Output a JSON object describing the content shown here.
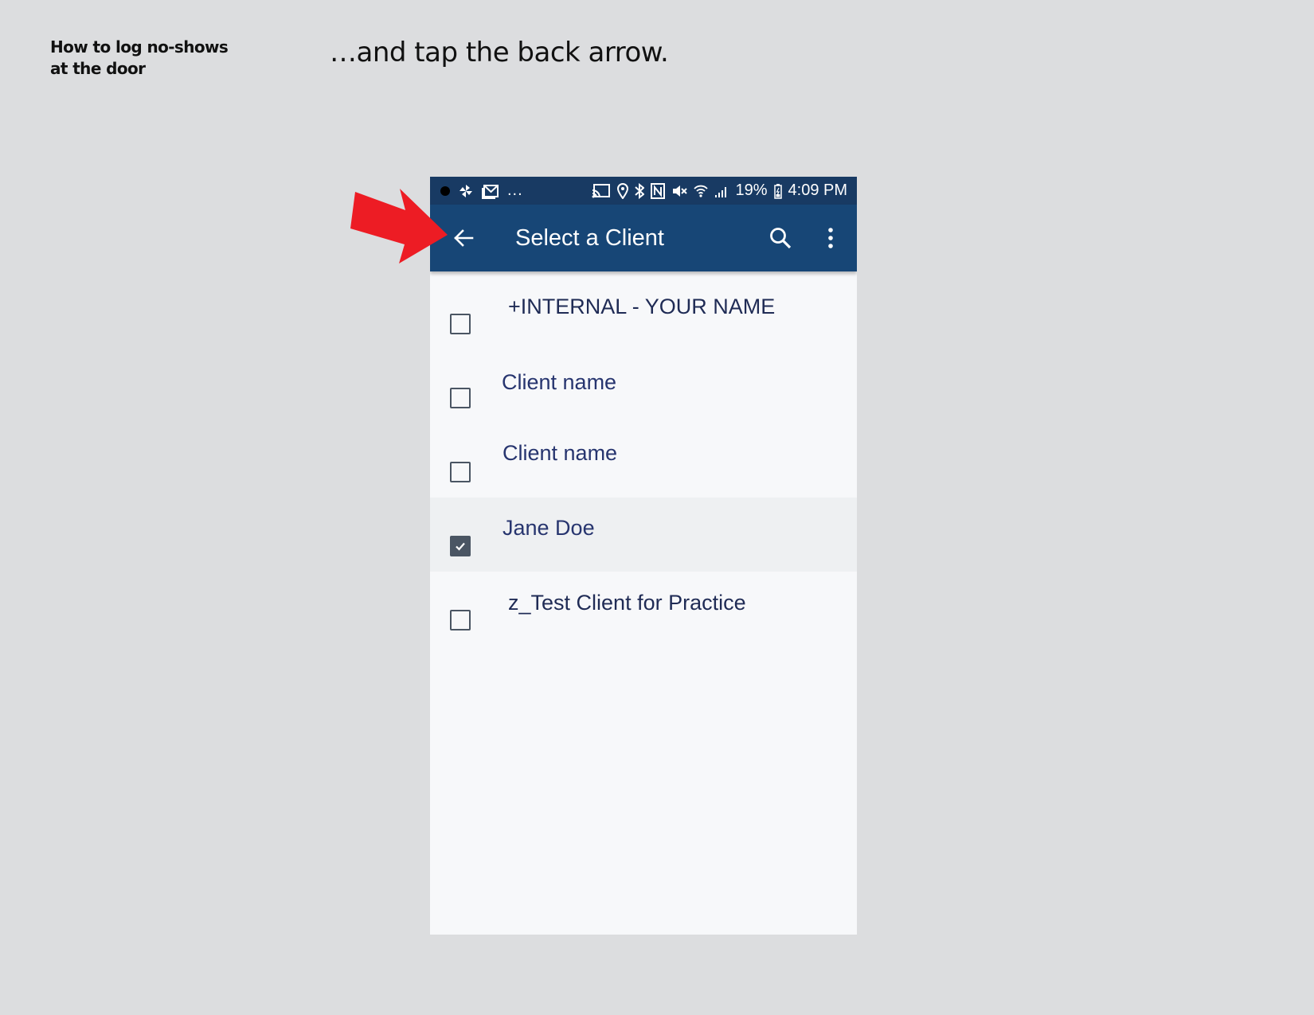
{
  "document": {
    "title_line1": "How to log no-shows",
    "title_line2": "at the door",
    "instruction": "…and tap the back arrow."
  },
  "status_bar": {
    "battery": "19%",
    "time": "4:09 PM",
    "overflow": "...",
    "icons_left": [
      "notification-dot-icon",
      "pinwheel-icon",
      "mail-icon"
    ],
    "icons_right": [
      "cast-icon",
      "location-icon",
      "bluetooth-icon",
      "nfc-icon",
      "mute-icon",
      "wifi-icon",
      "signal-icon",
      "battery-icon"
    ]
  },
  "app_bar": {
    "title": "Select a Client",
    "back_icon": "back-arrow-icon",
    "search_icon": "search-icon",
    "more_icon": "more-vert-icon"
  },
  "clients": [
    {
      "name": "+INTERNAL - YOUR NAME",
      "checked": false
    },
    {
      "name": "Client name",
      "checked": false
    },
    {
      "name": "Client name",
      "checked": false
    },
    {
      "name": "Jane Doe",
      "checked": true
    },
    {
      "name": "z_Test Client for Practice",
      "checked": false
    }
  ],
  "colors": {
    "status_bar": "#183a63",
    "app_bar": "#174676",
    "list_text": "#27356f",
    "callout_arrow": "#ed1c24",
    "page_bg": "#dcdddf"
  }
}
